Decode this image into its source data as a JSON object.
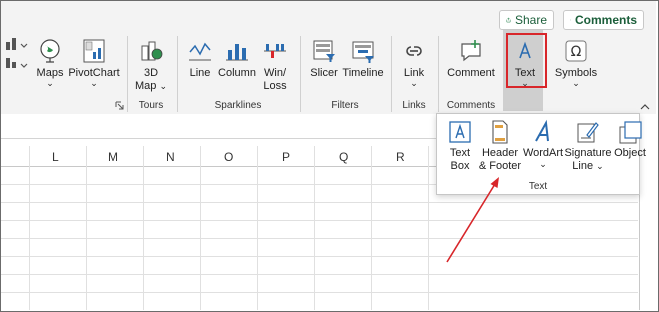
{
  "header": {
    "share_label": "Share",
    "comments_label": "Comments"
  },
  "ribbon": {
    "tools": {
      "maps": "Maps",
      "pivotchart": "PivotChart",
      "map3d_line1": "3D",
      "map3d_line2": "Map",
      "line": "Line",
      "column": "Column",
      "winloss_line1": "Win/",
      "winloss_line2": "Loss",
      "slicer": "Slicer",
      "timeline": "Timeline",
      "link": "Link",
      "comment": "Comment",
      "text": "Text",
      "symbols": "Symbols"
    },
    "groups": {
      "tours": "Tours",
      "sparklines": "Sparklines",
      "filters": "Filters",
      "links": "Links",
      "comments": "Comments"
    }
  },
  "text_dropdown": {
    "items": {
      "textbox_line1": "Text",
      "textbox_line2": "Box",
      "headerfooter_line1": "Header",
      "headerfooter_line2": "& Footer",
      "wordart": "WordArt",
      "sigline_line1": "Signature",
      "sigline_line2": "Line",
      "object": "Object"
    },
    "group_label": "Text"
  },
  "sheet": {
    "columns": [
      "L",
      "M",
      "N",
      "O",
      "P",
      "Q",
      "R"
    ]
  },
  "colors": {
    "highlight_red": "#d8262a",
    "arrow_red": "#d8262a",
    "share_green": "#1b7a44",
    "icon_blue": "#2b6cb0"
  },
  "icons": {
    "share": "share-icon",
    "comments": "speech-bubble-icon",
    "text": "text-a-icon",
    "symbols": "omega-icon"
  }
}
